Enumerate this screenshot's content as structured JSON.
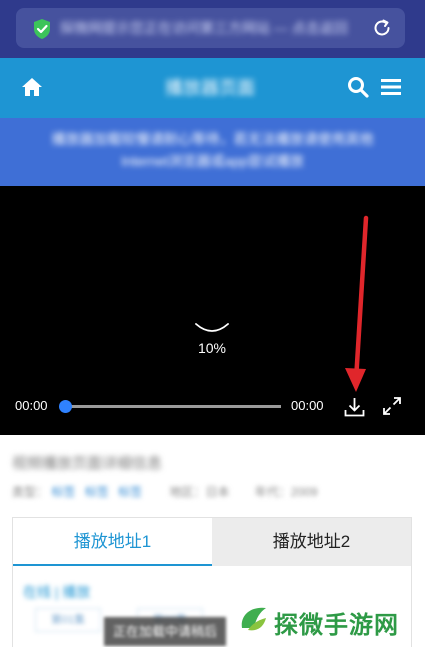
{
  "browser": {
    "url_text": "探微网提示您正在访问第三方网站 — 点击返回"
  },
  "header": {
    "site_title": "播放器页面"
  },
  "notice": {
    "line1": "播放器加载较慢请耐心等待，若无法播放请使用其他",
    "line2": "Internet浏览器或app尝试播放"
  },
  "player": {
    "loading_percent": "10%",
    "current_time": "00:00",
    "duration": "00:00",
    "progress": 0
  },
  "info": {
    "title": "视频播放页面详细信息",
    "meta_label": "类型：",
    "meta_tags": [
      "标签",
      "标签",
      "标签"
    ],
    "meta_region": "地区：日本",
    "meta_year": "年代：2009"
  },
  "tabs": {
    "items": [
      {
        "label": "播放地址1"
      },
      {
        "label": "播放地址2"
      }
    ]
  },
  "panel": {
    "heading": "在线 | 播放",
    "episodes": [
      "第01集",
      "第02集"
    ]
  },
  "toast": {
    "text": "正在加载中请稍后"
  },
  "watermark": {
    "text": "探微手游网"
  },
  "colors": {
    "browser_bar": "#2f3a8c",
    "header": "#1e95d3",
    "notice": "#3f6fd6",
    "accent": "#1e95d3",
    "progress": "#2f82ff",
    "annotation_arrow": "#e0262b",
    "watermark": "#2e9a46"
  },
  "icons": [
    "shield-check-icon",
    "reload-icon",
    "home-icon",
    "search-icon",
    "menu-icon",
    "download-icon",
    "fullscreen-icon",
    "watermark-logo-icon"
  ]
}
